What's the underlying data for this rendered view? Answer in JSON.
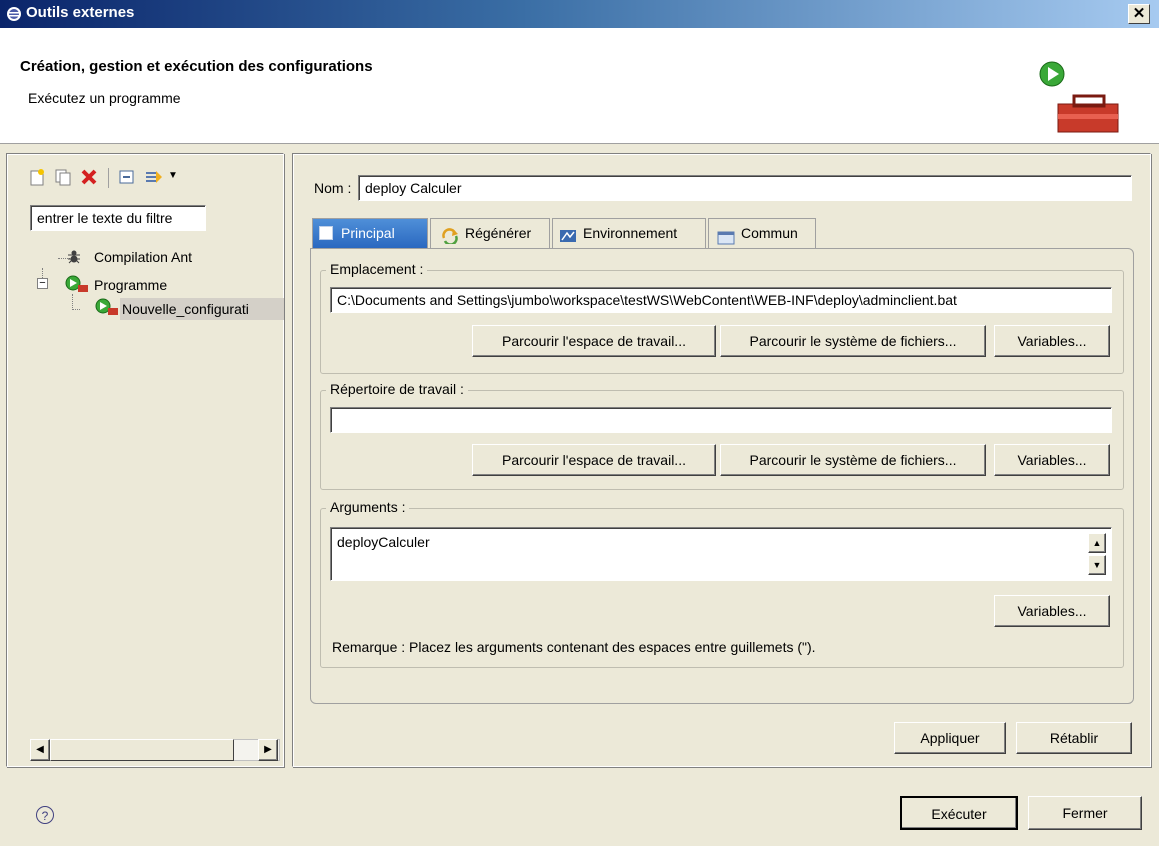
{
  "window": {
    "title": "Outils externes",
    "close": "✕"
  },
  "header": {
    "title": "Création, gestion et exécution des configurations",
    "subtitle": "Exécutez un programme"
  },
  "left_panel": {
    "filter_placeholder": "entrer le texte du filtre",
    "tree": [
      {
        "label": "Compilation Ant"
      },
      {
        "label": "Programme"
      },
      {
        "label": "Nouvelle_configurati"
      }
    ]
  },
  "right_panel": {
    "name_label": "Nom :",
    "name_value": "deploy Calculer",
    "tabs": [
      {
        "label": "Principal"
      },
      {
        "label": "Régénérer"
      },
      {
        "label": "Environnement"
      },
      {
        "label": "Commun"
      }
    ],
    "emplacement": {
      "label": "Emplacement :",
      "value": "C:\\Documents and Settings\\jumbo\\workspace\\testWS\\WebContent\\WEB-INF\\deploy\\adminclient.bat",
      "btn_workspace": "Parcourir l'espace de travail...",
      "btn_filesystem": "Parcourir le système de fichiers...",
      "btn_variables": "Variables..."
    },
    "working_dir": {
      "label": "Répertoire de travail :",
      "value": "",
      "btn_workspace": "Parcourir l'espace de travail...",
      "btn_filesystem": "Parcourir le système de fichiers...",
      "btn_variables": "Variables..."
    },
    "arguments": {
      "label": "Arguments :",
      "value": "deployCalculer",
      "btn_variables": "Variables...",
      "note": "Remarque : Placez les arguments contenant des espaces entre guillemets (\")."
    },
    "apply_button": "Appliquer",
    "revert_button": "Rétablir"
  },
  "footer": {
    "help": "?",
    "run_button": "Exécuter",
    "close_button": "Fermer"
  },
  "colors": {
    "title_start": "#0a246a",
    "title_end": "#a6caf0",
    "dialog_bg": "#ece9d8",
    "tab_active": "#2a68c0"
  }
}
